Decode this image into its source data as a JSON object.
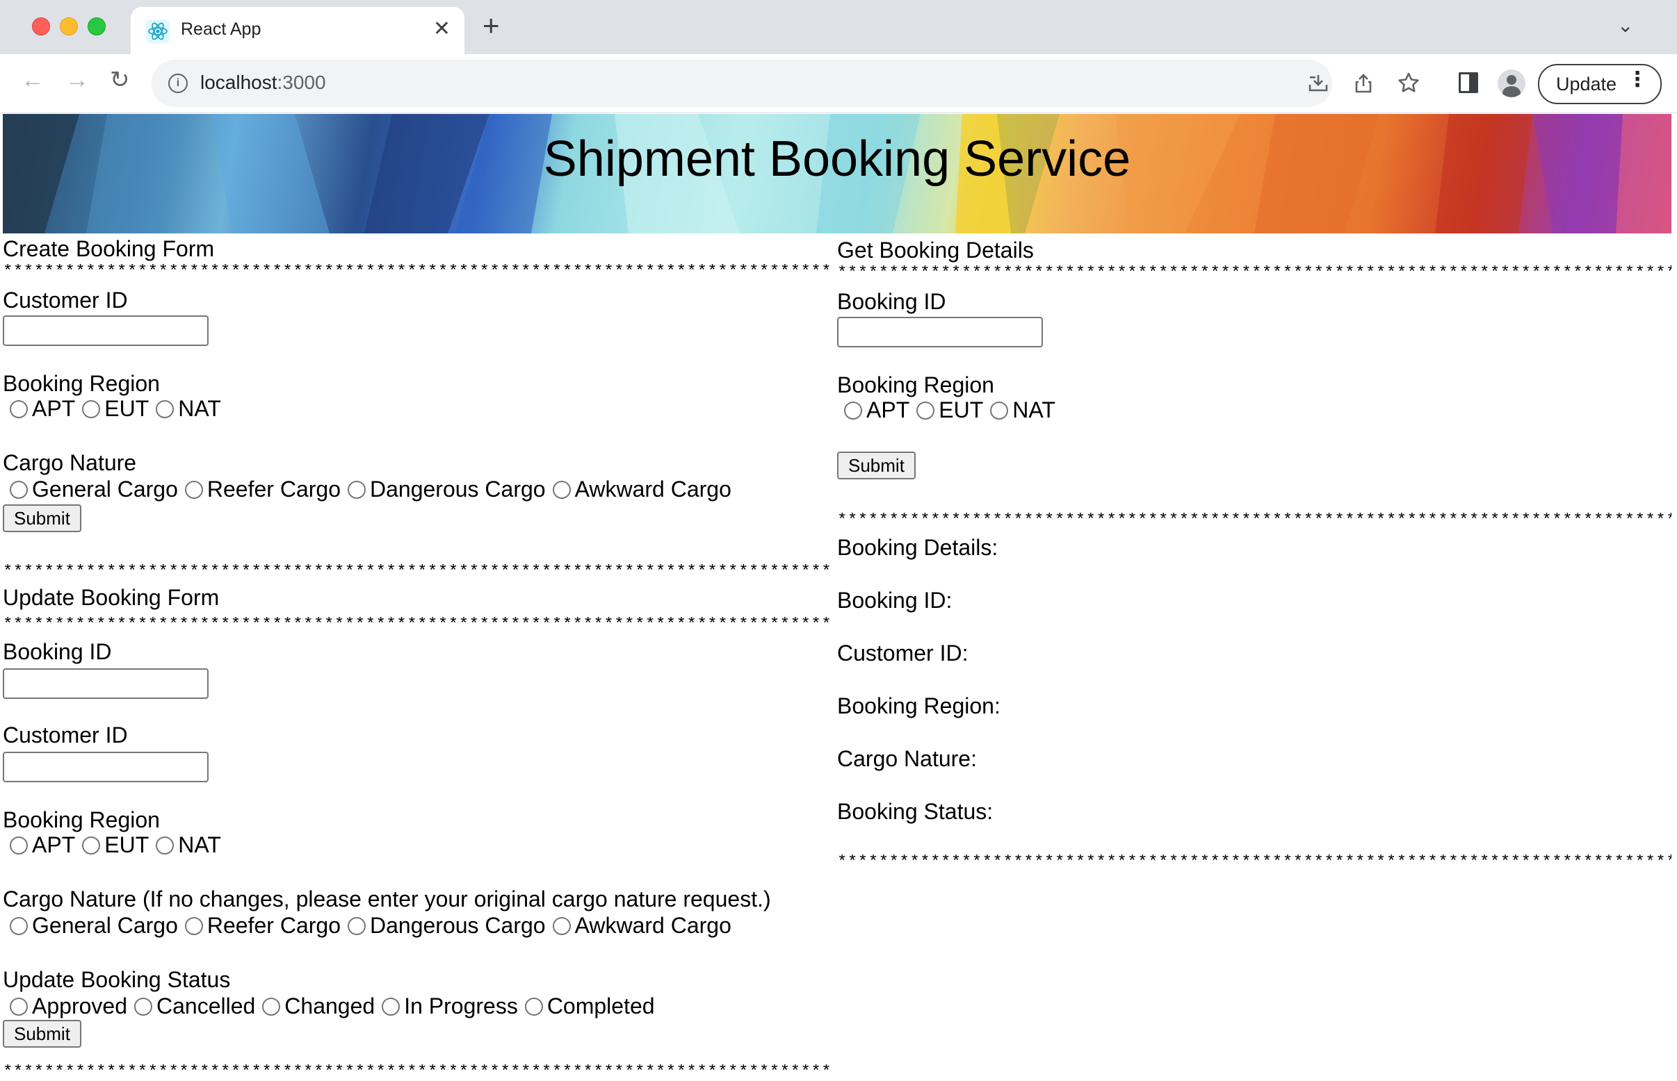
{
  "browser": {
    "tab_title": "React App",
    "url_host": "localhost",
    "url_port": ":3000",
    "update_label": "Update",
    "icons": [
      "back-icon",
      "forward-icon",
      "reload-icon",
      "info-icon",
      "install-icon",
      "share-icon",
      "star-icon",
      "side-panel-icon",
      "profile-icon",
      "menu-icon"
    ]
  },
  "banner": {
    "title": "Shipment Booking Service"
  },
  "stars": "*********************************************************************************************************************",
  "create": {
    "heading": "Create Booking Form",
    "customer_label": "Customer ID",
    "region_label": "Booking Region",
    "regions": [
      "APT",
      "EUT",
      "NAT"
    ],
    "cargo_label": "Cargo Nature",
    "cargo": [
      "General Cargo",
      "Reefer Cargo",
      "Dangerous Cargo",
      "Awkward Cargo"
    ],
    "submit": "Submit"
  },
  "update": {
    "heading": "Update Booking Form",
    "booking_label": "Booking ID",
    "customer_label": "Customer ID",
    "region_label": "Booking Region",
    "regions": [
      "APT",
      "EUT",
      "NAT"
    ],
    "cargo_label": "Cargo Nature (If no changes, please enter your original cargo nature request.)",
    "cargo": [
      "General Cargo",
      "Reefer Cargo",
      "Dangerous Cargo",
      "Awkward Cargo"
    ],
    "status_label": "Update Booking Status",
    "statuses": [
      "Approved",
      "Cancelled",
      "Changed",
      "In Progress",
      "Completed"
    ],
    "submit": "Submit"
  },
  "get": {
    "heading": "Get Booking Details",
    "booking_label": "Booking ID",
    "region_label": "Booking Region",
    "regions": [
      "APT",
      "EUT",
      "NAT"
    ],
    "submit": "Submit",
    "details": {
      "title": "Booking Details:",
      "booking_id": "Booking ID:",
      "customer_id": "Customer ID:",
      "region": "Booking Region:",
      "cargo": "Cargo Nature:",
      "status": "Booking Status:"
    }
  }
}
